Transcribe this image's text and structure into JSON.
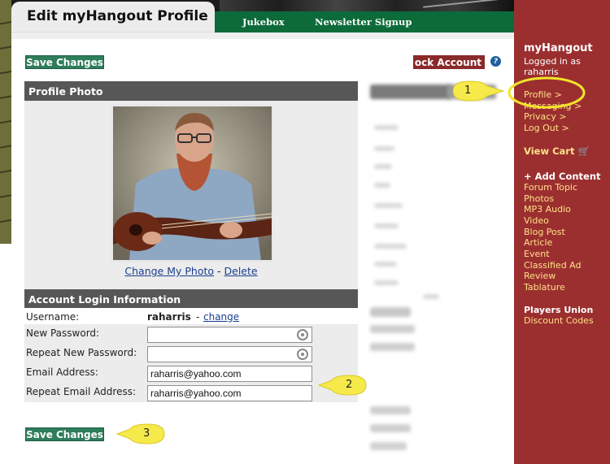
{
  "header": {
    "title": "Edit myHangout Profile",
    "nav": [
      "Jukebox",
      "Newsletter Signup"
    ]
  },
  "toolbar": {
    "save_top": "Save Changes",
    "lock_account": "ock Account",
    "save_bottom": "Save Changes"
  },
  "profile_photo": {
    "header": "Profile Photo",
    "change_link": "Change My Photo",
    "separator": " - ",
    "delete_link": "Delete"
  },
  "account": {
    "header": "Account Login Information",
    "username_label": "Username:",
    "username_value": "raharris",
    "username_sep": " - ",
    "username_change": "change",
    "new_password_label": "New Password:",
    "repeat_password_label": "Repeat New Password:",
    "email_label": "Email Address:",
    "email_value": "raharris@yahoo.com",
    "repeat_email_label": "Repeat Email Address:",
    "repeat_email_value": "raharris@yahoo.com"
  },
  "sidebar": {
    "title": "myHangout",
    "logged_in_as": "Logged in as",
    "user": "raharris",
    "links": [
      "Profile >",
      "Messaging >",
      "Privacy >",
      "Log Out >"
    ],
    "view_cart": "View Cart",
    "add_content": "+ Add Content",
    "content_items": [
      "Forum Topic",
      "Photos",
      "MP3 Audio",
      "Video",
      "Blog Post",
      "Article",
      "Event",
      "Classified Ad",
      "Review",
      "Tablature"
    ],
    "players_union": "Players Union",
    "discount_codes": "Discount Codes"
  },
  "callouts": [
    "1",
    "2",
    "3"
  ],
  "colors": {
    "nav_green": "#0d6b3a",
    "button_green": "#2e7d5b",
    "sidebar_red": "#9b2f2f",
    "link_yellow": "#ffe08a",
    "callout_yellow": "#f6e94a"
  }
}
